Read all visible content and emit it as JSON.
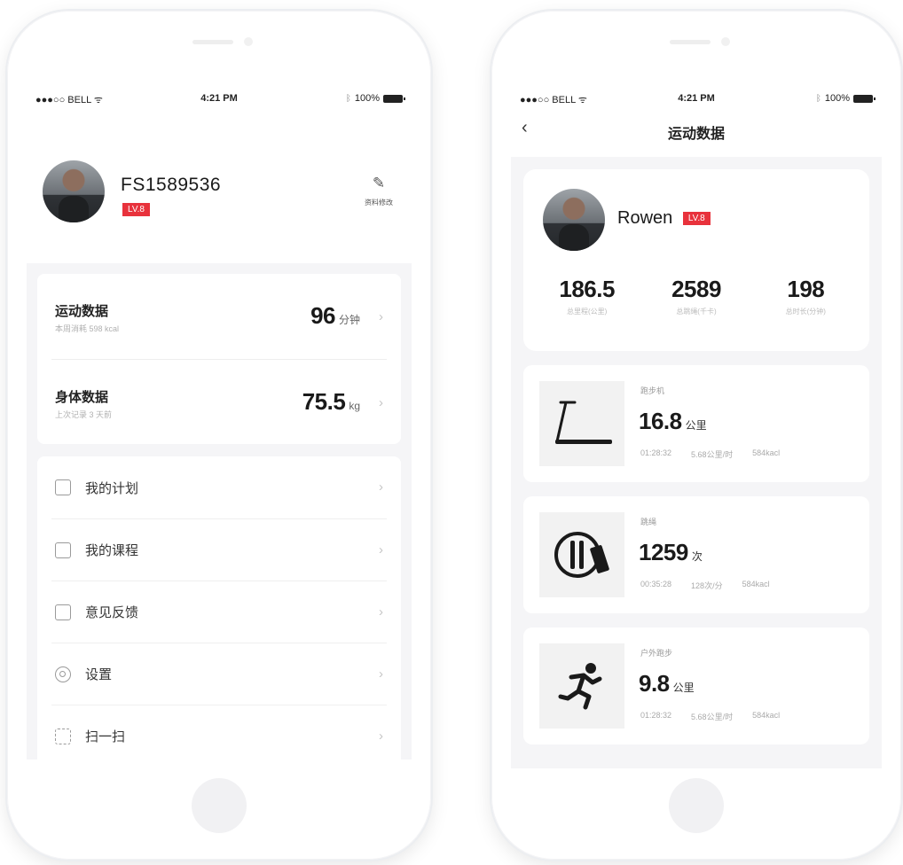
{
  "status": {
    "carrier": "●●●○○ BELL ᯤ",
    "time": "4:21 PM",
    "battery": "100%"
  },
  "left": {
    "profile": {
      "username": "FS1589536",
      "level": "LV.8",
      "edit_label": "资料修改"
    },
    "data_rows": [
      {
        "title": "运动数据",
        "subtitle": "本周消耗 598 kcal",
        "value": "96",
        "unit": "分钟"
      },
      {
        "title": "身体数据",
        "subtitle": "上次记录 3 天前",
        "value": "75.5",
        "unit": "kg"
      }
    ],
    "menu": [
      {
        "label": "我的计划",
        "icon": "plan-icon"
      },
      {
        "label": "我的课程",
        "icon": "course-icon"
      },
      {
        "label": "意见反馈",
        "icon": "feedback-icon"
      },
      {
        "label": "设置",
        "icon": "settings-icon"
      },
      {
        "label": "扫一扫",
        "icon": "scan-icon"
      }
    ]
  },
  "right": {
    "nav_title": "运动数据",
    "summary": {
      "name": "Rowen",
      "level": "LV.8",
      "stats": [
        {
          "value": "186.5",
          "label": "总里程(公里)"
        },
        {
          "value": "2589",
          "label": "总跳绳(千卡)"
        },
        {
          "value": "198",
          "label": "总时长(分钟)"
        }
      ]
    },
    "activities": [
      {
        "name": "跑步机",
        "value": "16.8",
        "unit": "公里",
        "meta": [
          "01:28:32",
          "5.68公里/时",
          "584kacl"
        ],
        "icon": "treadmill-icon"
      },
      {
        "name": "跳绳",
        "value": "1259",
        "unit": "次",
        "meta": [
          "00:35:28",
          "128次/分",
          "584kacl"
        ],
        "icon": "jump-rope-icon"
      },
      {
        "name": "户外跑步",
        "value": "9.8",
        "unit": "公里",
        "meta": [
          "01:28:32",
          "5.68公里/时",
          "584kacl"
        ],
        "icon": "runner-icon"
      }
    ]
  }
}
